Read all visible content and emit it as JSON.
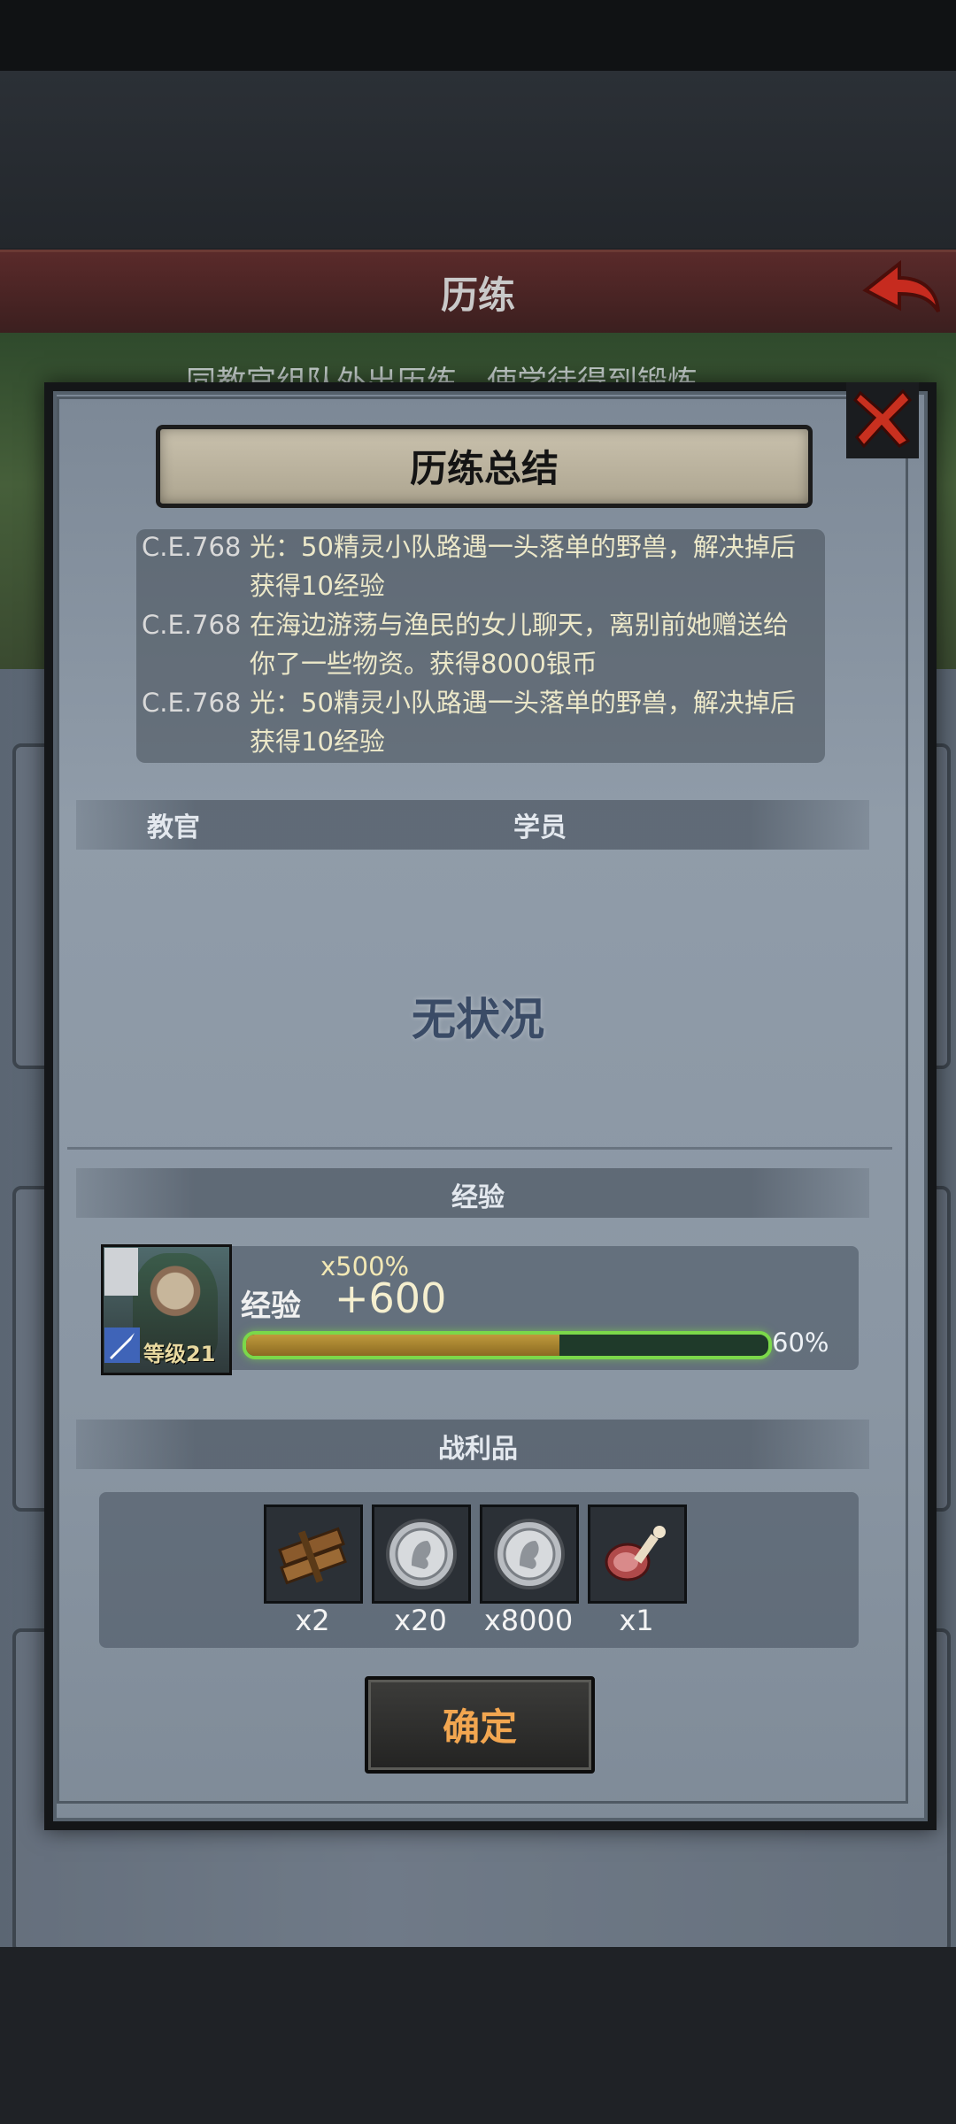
{
  "background": {
    "title": "历练",
    "subtitle": "同教官组队外出历练，使学徒得到锻炼"
  },
  "dialog": {
    "title": "历练总结",
    "log": [
      {
        "date": "C.E.768",
        "text": "光：50精灵小队路遇一头落单的野兽，解决掉后获得10经验"
      },
      {
        "date": "C.E.768",
        "text": "在海边游荡与渔民的女儿聊天，离别前她赠送给你了一些物资。获得8000银币"
      },
      {
        "date": "C.E.768",
        "text": "光：50精灵小队路遇一头落单的野兽，解决掉后获得10经验"
      }
    ],
    "columns": {
      "instructor": "教官",
      "trainee": "学员"
    },
    "empty_message": "无状况",
    "exp_section": {
      "header": "经验",
      "label": "经验",
      "multiplier": "x500%",
      "gain": "+600",
      "progress": 0.6,
      "progress_text": "60%",
      "level_text": "等级21"
    },
    "loot_section": {
      "header": "战利品",
      "items": [
        {
          "icon": "wood-planks-icon",
          "count": "x2"
        },
        {
          "icon": "silver-coin-icon",
          "count": "x20"
        },
        {
          "icon": "silver-coin-icon",
          "count": "x8000"
        },
        {
          "icon": "meat-leg-icon",
          "count": "x1"
        }
      ]
    },
    "confirm_label": "确定"
  },
  "colors": {
    "accent_green": "#7bd84a",
    "confirm_text": "#f2a650",
    "close_red": "#c8301f"
  }
}
